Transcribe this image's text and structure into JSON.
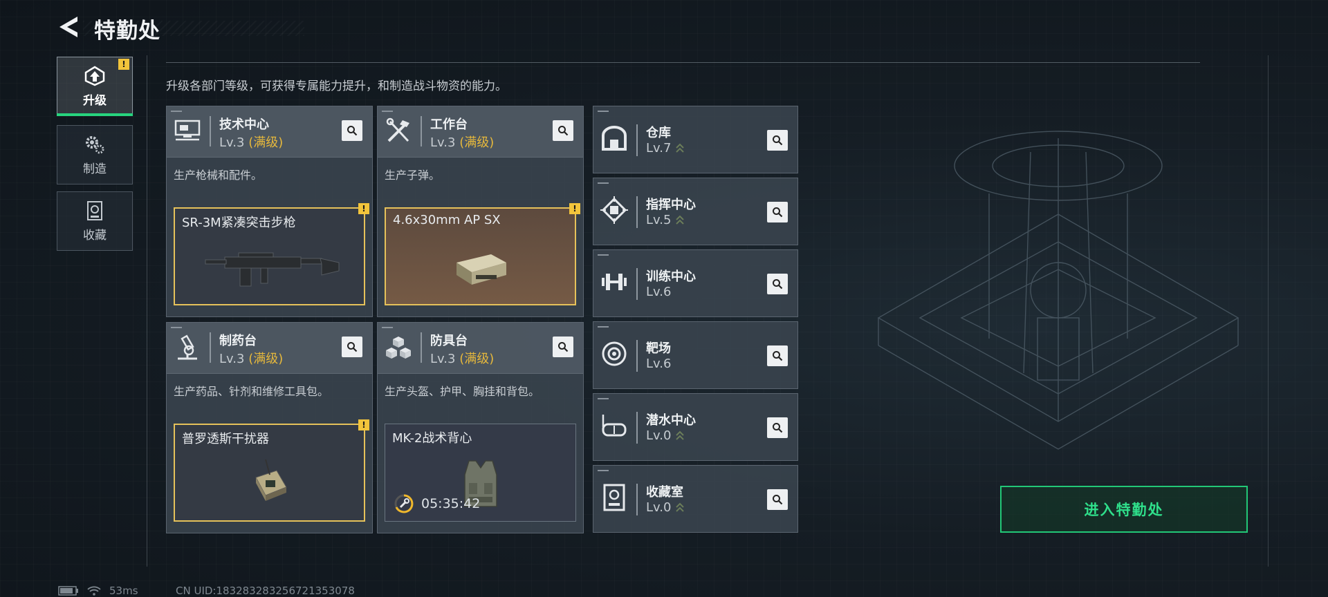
{
  "header": {
    "title": "特勤处"
  },
  "sidebar": {
    "tabs": [
      {
        "label": "升级",
        "active": true,
        "badge": "!"
      },
      {
        "label": "制造",
        "active": false
      },
      {
        "label": "收藏",
        "active": false
      }
    ]
  },
  "description": "升级各部门等级，可获得专属能力提升，和制造战斗物资的能力。",
  "departments": [
    {
      "name": "技术中心",
      "level": "Lv.3",
      "max": "(满级)",
      "desc": "生产枪械和配件。",
      "item": {
        "name": "SR-3M紧凑突击步枪",
        "badge": "!"
      }
    },
    {
      "name": "工作台",
      "level": "Lv.3",
      "max": "(满级)",
      "desc": "生产子弹。",
      "item": {
        "name": "4.6x30mm AP SX",
        "badge": "!"
      }
    },
    {
      "name": "制药台",
      "level": "Lv.3",
      "max": "(满级)",
      "desc": "生产药品、针剂和维修工具包。",
      "item": {
        "name": "普罗透斯干扰器",
        "badge": "!"
      }
    },
    {
      "name": "防具台",
      "level": "Lv.3",
      "max": "(满级)",
      "desc": "生产头盔、护甲、胸挂和背包。",
      "item": {
        "name": "MK-2战术背心",
        "timer": "05:35:42"
      }
    }
  ],
  "facilities": [
    {
      "name": "仓库",
      "level": "Lv.7"
    },
    {
      "name": "指挥中心",
      "level": "Lv.5"
    },
    {
      "name": "训练中心",
      "level": "Lv.6"
    },
    {
      "name": "靶场",
      "level": "Lv.6"
    },
    {
      "name": "潜水中心",
      "level": "Lv.0"
    },
    {
      "name": "收藏室",
      "level": "Lv.0"
    }
  ],
  "enter_button": "进入特勤处",
  "status": {
    "ping": "53ms",
    "uid": "CN UID:18328328325672135307​8"
  },
  "colors": {
    "accent_green": "#27d47e",
    "maxed_gold": "#e6b83c",
    "badge_yellow": "#f2c43b"
  }
}
